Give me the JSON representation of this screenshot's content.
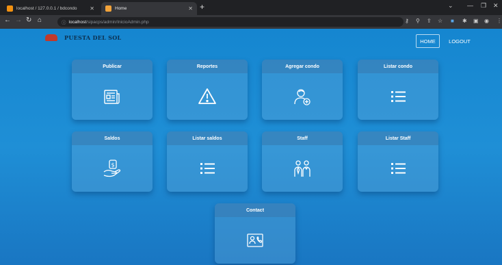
{
  "browser": {
    "tabs": [
      {
        "title": "localhost / 127.0.0.1 / bdcondo",
        "favicon_color": "#f29111"
      },
      {
        "title": "Home",
        "favicon_color": "#f2a33a"
      }
    ],
    "url_host": "localhost",
    "url_path": "/sipacps/admin/InicioAdmin.php"
  },
  "header": {
    "logo_text": "PUESTA DEL SOL",
    "nav": {
      "home": "HOME",
      "logout": "LOGOUT"
    }
  },
  "cards": [
    {
      "label": "Publicar",
      "icon": "newspaper-icon"
    },
    {
      "label": "Reportes",
      "icon": "warning-icon"
    },
    {
      "label": "Agregar condo",
      "icon": "add-user-icon"
    },
    {
      "label": "Listar condo",
      "icon": "list-icon"
    },
    {
      "label": "Saldos",
      "icon": "money-hand-icon"
    },
    {
      "label": "Listar saldos",
      "icon": "list-icon"
    },
    {
      "label": "Staff",
      "icon": "staff-icon"
    },
    {
      "label": "Listar Staff",
      "icon": "list-icon"
    },
    {
      "label": "Contact",
      "icon": "contact-icon"
    }
  ],
  "colors": {
    "page_bg": "#1b7fc4",
    "accent_logo": "#c0392b"
  }
}
